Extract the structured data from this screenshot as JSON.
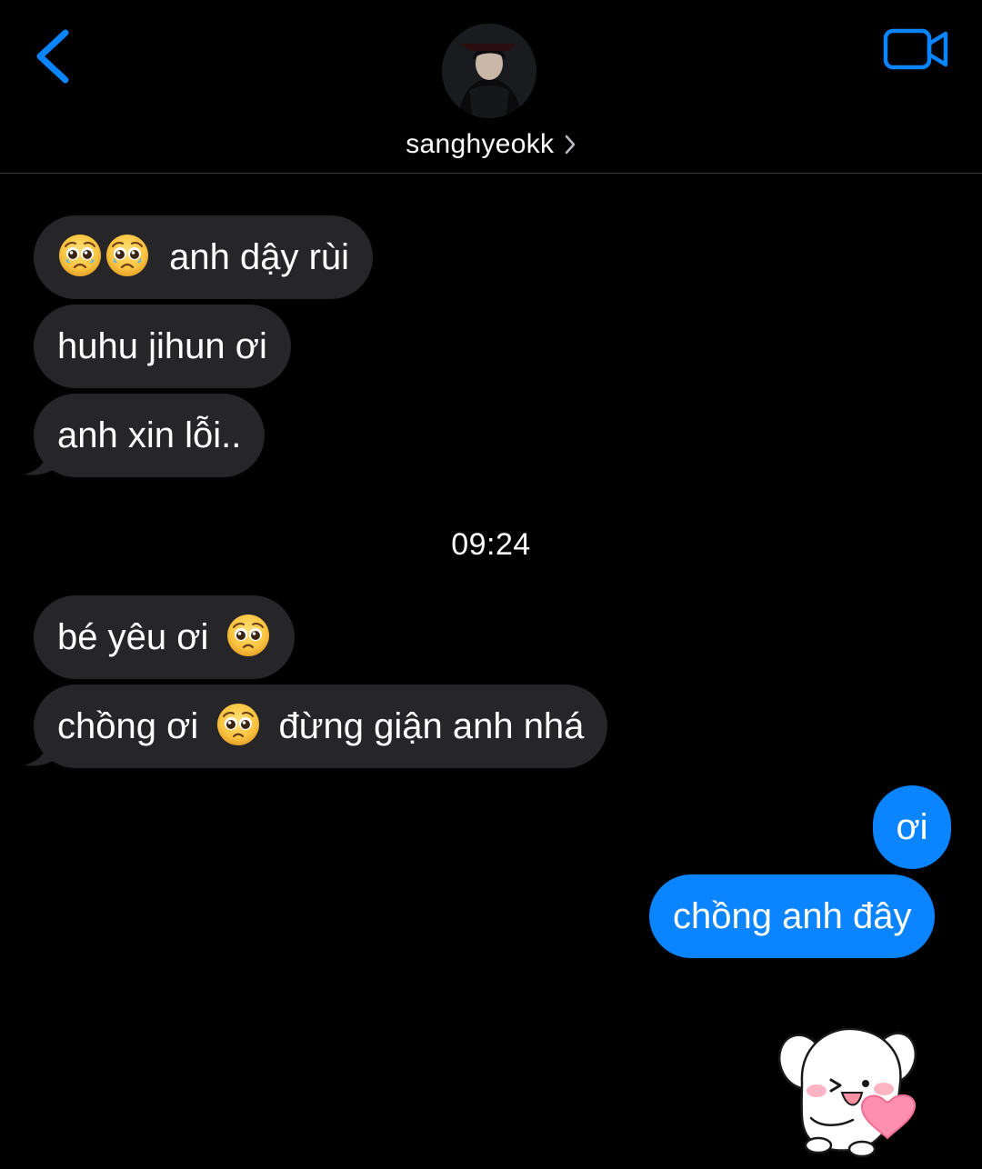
{
  "header": {
    "contact_name": "sanghyeokk"
  },
  "messages": [
    {
      "id": "m1",
      "direction": "incoming",
      "text": "anh dậy rùi",
      "emojis_before": [
        "pleading-tears-emoji",
        "pleading-tears-emoji"
      ]
    },
    {
      "id": "m2",
      "direction": "incoming",
      "text": "huhu jihun ơi"
    },
    {
      "id": "m3",
      "direction": "incoming",
      "text": "anh xin lỗi.."
    },
    {
      "id": "m4",
      "direction": "incoming",
      "text_before": "bé yêu ơi",
      "emoji_after": "pleading-face-emoji"
    },
    {
      "id": "m5",
      "direction": "incoming",
      "text_before": "chồng ơi",
      "emoji_mid": "pleading-face-emoji",
      "text_after": "đừng giận anh nhá"
    },
    {
      "id": "m6",
      "direction": "outgoing",
      "text": "ơi"
    },
    {
      "id": "m7",
      "direction": "outgoing",
      "text": "chồng anh đây"
    }
  ],
  "timestamp": "09:24",
  "sticker": {
    "icon": "puppy-heart-sticker"
  },
  "colors": {
    "background": "#000000",
    "incoming_bubble": "#262628",
    "outgoing_bubble": "#0a84ff",
    "accent": "#0a84ff"
  }
}
